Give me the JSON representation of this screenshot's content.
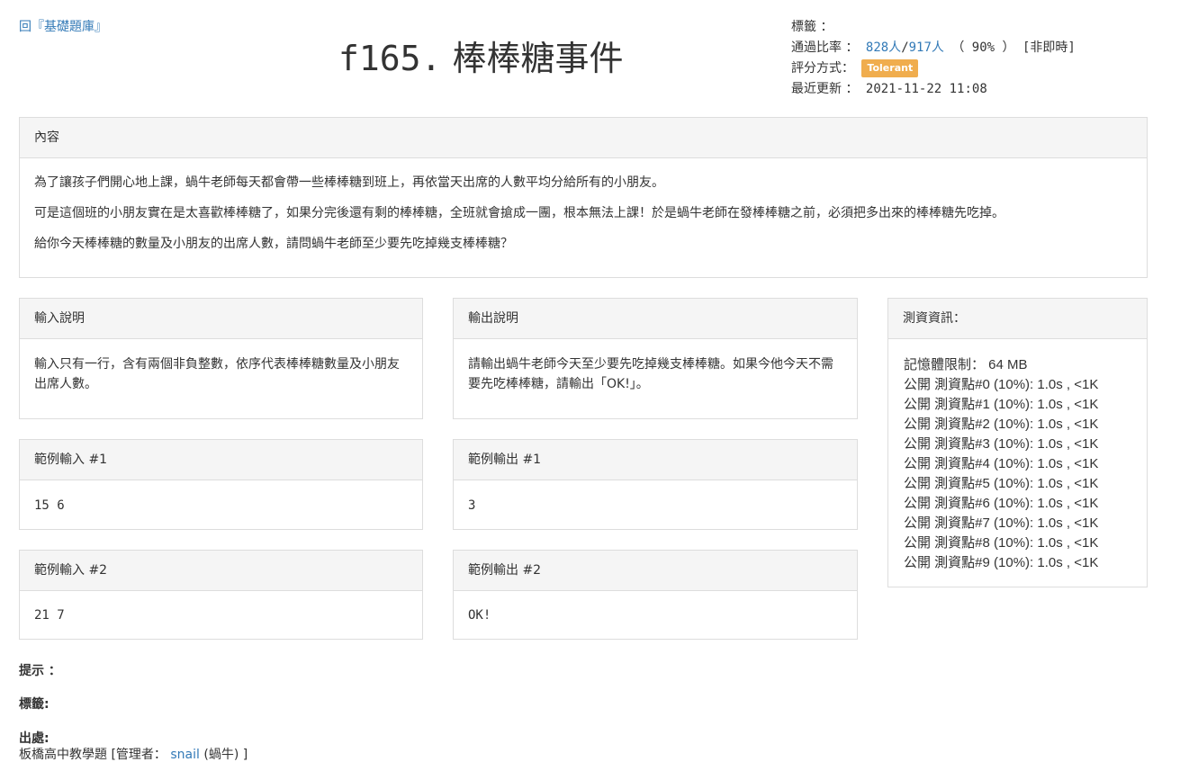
{
  "header": {
    "back_link": "回『基礎題庫』",
    "problem_code": "f165.",
    "problem_title": "棒棒糖事件"
  },
  "meta": {
    "tags_label": "標籤 ：",
    "pass_rate_label": "通過比率 ：",
    "passed": "828人",
    "separator": "/",
    "total": "917人",
    "percent": "（ 90% ）",
    "realtime": "[非即時]",
    "scoring_label": "評分方式：",
    "scoring_badge": "Tolerant",
    "updated_label": "最近更新 ：",
    "updated_value": "2021-11-22 11:08"
  },
  "content": {
    "header": "內容",
    "paragraphs": [
      "為了讓孩子們開心地上課，蝸牛老師每天都會帶一些棒棒糖到班上，再依當天出席的人數平均分給所有的小朋友。",
      "可是這個班的小朋友實在是太喜歡棒棒糖了，如果分完後還有剩的棒棒糖，全班就會搶成一團，根本無法上課！於是蝸牛老師在發棒棒糖之前，必須把多出來的棒棒糖先吃掉。",
      "給你今天棒棒糖的數量及小朋友的出席人數，請問蝸牛老師至少要先吃掉幾支棒棒糖？"
    ]
  },
  "input_desc": {
    "header": "輸入說明",
    "body": "輸入只有一行，含有兩個非負整數，依序代表棒棒糖數量及小朋友出席人數。"
  },
  "output_desc": {
    "header": "輸出說明",
    "body": "請輸出蝸牛老師今天至少要先吃掉幾支棒棒糖。如果今他今天不需要先吃棒棒糖，請輸出「OK!」。"
  },
  "sample_in_1": {
    "header": "範例輸入 #1",
    "body": "15 6"
  },
  "sample_out_1": {
    "header": "範例輸出 #1",
    "body": "3"
  },
  "sample_in_2": {
    "header": "範例輸入 #2",
    "body": "21 7"
  },
  "sample_out_2": {
    "header": "範例輸出 #2",
    "body": "OK!"
  },
  "testinfo": {
    "header": "測資資訊：",
    "memory": "記憶體限制： 64 MB",
    "cases": [
      "公開 測資點#0 (10%): 1.0s , <1K",
      "公開 測資點#1 (10%): 1.0s , <1K",
      "公開 測資點#2 (10%): 1.0s , <1K",
      "公開 測資點#3 (10%): 1.0s , <1K",
      "公開 測資點#4 (10%): 1.0s , <1K",
      "公開 測資點#5 (10%): 1.0s , <1K",
      "公開 測資點#6 (10%): 1.0s , <1K",
      "公開 測資點#7 (10%): 1.0s , <1K",
      "公開 測資點#8 (10%): 1.0s , <1K",
      "公開 測資點#9 (10%): 1.0s , <1K"
    ]
  },
  "footer": {
    "hint_label": "提示 ：",
    "tags_label": "標籤:",
    "source_label": "出處:",
    "source_prefix": "板橋高中教學題 [管理者：",
    "source_admin": "snail",
    "source_suffix": "(蝸牛) ]"
  },
  "colors": {
    "link": "#337ab7",
    "badge": "#f0ad4e",
    "panel_header": "#f5f5f5",
    "border": "#dddddd"
  }
}
